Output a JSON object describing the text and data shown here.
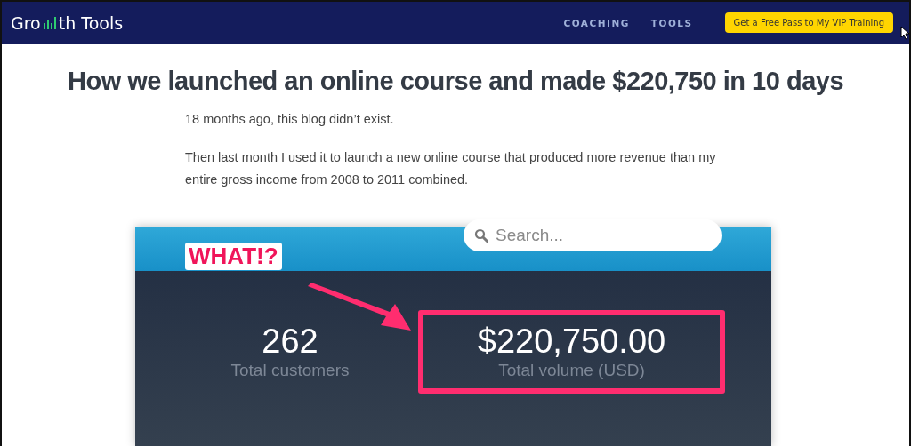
{
  "header": {
    "logo": {
      "before": "Gro",
      "after": "th Tools"
    },
    "nav": [
      "COACHING",
      "TOOLS"
    ],
    "cta": "Get a Free Pass to My VIP Training"
  },
  "article": {
    "title": "How we launched an online course and made $220,750 in 10 days",
    "paragraphs": [
      "18 months ago, this blog didn’t exist.",
      "Then last month I used it to launch a new online course that produced more revenue than my entire gross income from 2008 to 2011 combined."
    ]
  },
  "screenshot": {
    "search": {
      "placeholder": "Search..."
    },
    "annotation": "WHAT!?",
    "stats": [
      {
        "value": "262",
        "label": "Total customers",
        "highlighted": false
      },
      {
        "value": "$220,750.00",
        "label": "Total volume (USD)",
        "highlighted": true
      }
    ]
  }
}
